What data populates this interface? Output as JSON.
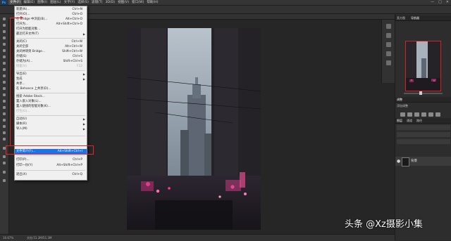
{
  "app": {
    "logo": "Ps"
  },
  "menubar": {
    "items": [
      "文件(F)",
      "编辑(E)",
      "图像(I)",
      "图层(L)",
      "文字(Y)",
      "选择(S)",
      "滤镜(T)",
      "3D(D)",
      "视图(V)",
      "窗口(W)",
      "帮助(H)"
    ],
    "active_index": 0
  },
  "window_controls": {
    "minimize": "—",
    "maximize": "□",
    "close": "✕"
  },
  "file_menu": {
    "items": [
      {
        "label": "新建(N)...",
        "shortcut": "Ctrl+N"
      },
      {
        "label": "打开(O)...",
        "shortcut": "Ctrl+O"
      },
      {
        "label": "在 Bridge 中浏览(B)...",
        "shortcut": "Alt+Ctrl+O"
      },
      {
        "label": "打开为...",
        "shortcut": "Alt+Shift+Ctrl+O"
      },
      {
        "label": "打开为智能对象...",
        "shortcut": ""
      },
      {
        "label": "最近打开文件(T)",
        "shortcut": "",
        "submenu": true
      },
      {
        "label": "关闭(C)",
        "shortcut": "Ctrl+W"
      },
      {
        "label": "关闭全部",
        "shortcut": "Alt+Ctrl+W"
      },
      {
        "label": "关闭并转到 Bridge...",
        "shortcut": "Shift+Ctrl+W"
      },
      {
        "label": "存储(S)",
        "shortcut": "Ctrl+S"
      },
      {
        "label": "存储为(A)...",
        "shortcut": "Shift+Ctrl+S"
      },
      {
        "label": "恢复(V)",
        "shortcut": "F12",
        "disabled": true
      },
      {
        "label": "导出(E)",
        "shortcut": "",
        "submenu": true
      },
      {
        "label": "生成",
        "shortcut": "",
        "submenu": true
      },
      {
        "label": "共享...",
        "shortcut": ""
      },
      {
        "label": "在 Behance 上共享(D)...",
        "shortcut": ""
      },
      {
        "label": "搜索 Adobe Stock...",
        "shortcut": ""
      },
      {
        "label": "置入嵌入对象(L)...",
        "shortcut": ""
      },
      {
        "label": "置入链接的智能对象(K)...",
        "shortcut": ""
      },
      {
        "label": "打包(G)...",
        "shortcut": "",
        "disabled": true
      },
      {
        "label": "自动(U)",
        "shortcut": "",
        "submenu": true
      },
      {
        "label": "脚本(R)",
        "shortcut": "",
        "submenu": true
      },
      {
        "label": "导入(M)",
        "shortcut": "",
        "submenu": true
      },
      {
        "label": "文件简介(F)...",
        "shortcut": "Alt+Shift+Ctrl+I",
        "highlighted": true
      },
      {
        "label": "打印(P)...",
        "shortcut": "Ctrl+P"
      },
      {
        "label": "打印一份(Y)",
        "shortcut": "Alt+Shift+Ctrl+P"
      },
      {
        "label": "退出(X)",
        "shortcut": "Ctrl+Q"
      }
    ]
  },
  "right_panels": {
    "navigator_tabs": [
      "直方图",
      "导航器"
    ],
    "adjustments_tabs": [
      "调整"
    ],
    "adjustments_hint": "添加调整",
    "layers_tabs": [
      "图层",
      "通道",
      "路径"
    ],
    "layer_name": "背景"
  },
  "status": {
    "zoom": "16.67%",
    "doc": "文档:51.3M/51.3M"
  },
  "watermark": "头条 @Xz摄影小集",
  "colors": {
    "highlight_box": "#e3262b",
    "menu_highlight": "#1a73e8"
  }
}
